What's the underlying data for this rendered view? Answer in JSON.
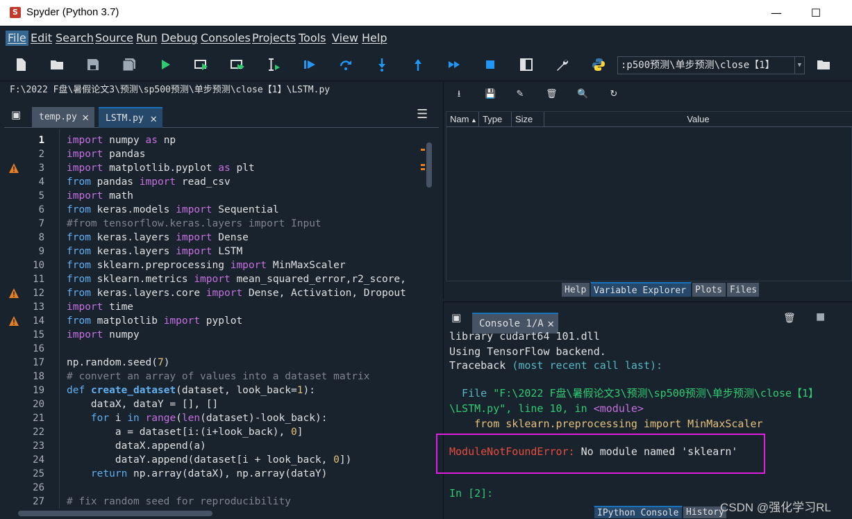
{
  "window": {
    "title": "Spyder (Python 3.7)",
    "minimize": "—",
    "maximize": "☐"
  },
  "menu": [
    "File",
    "Edit",
    "Search",
    "Source",
    "Run",
    "Debug",
    "Consoles",
    "Projects",
    "Tools",
    "View",
    "Help"
  ],
  "toolbar": {
    "path_value": ":p500预测\\单步预测\\close【1】"
  },
  "editor": {
    "file_path": "F:\\2022 F盘\\暑假论文3\\预测\\sp500预测\\单步预测\\close【1】\\LSTM.py",
    "tabs": [
      {
        "label": "temp.py",
        "active": false
      },
      {
        "label": "LSTM.py",
        "active": true
      }
    ],
    "current_line": 1,
    "warning_lines": [
      3,
      12,
      14
    ],
    "line_numbers": [
      "1",
      "2",
      "3",
      "4",
      "5",
      "6",
      "7",
      "8",
      "9",
      "10",
      "11",
      "12",
      "13",
      "14",
      "15",
      "16",
      "17",
      "18",
      "19",
      "20",
      "21",
      "22",
      "23",
      "24",
      "25",
      "26",
      "27"
    ],
    "lines": [
      "import numpy as np",
      "import pandas",
      "import matplotlib.pyplot as plt",
      "from pandas import read_csv",
      "import math",
      "from keras.models import Sequential",
      "#from tensorflow.keras.layers import Input",
      "from keras.layers import Dense",
      "from keras.layers import LSTM",
      "from sklearn.preprocessing import MinMaxScaler",
      "from sklearn.metrics import mean_squared_error,r2_score,",
      "from keras.layers.core import Dense, Activation, Dropout",
      "import time",
      "from matplotlib import pyplot",
      "import numpy",
      "",
      "np.random.seed(7)",
      "# convert an array of values into a dataset matrix",
      "def create_dataset(dataset, look_back=1):",
      "    dataX, dataY = [], []",
      "    for i in range(len(dataset)-look_back):",
      "        a = dataset[i:(i+look_back), 0]",
      "        dataX.append(a)",
      "        dataY.append(dataset[i + look_back, 0])",
      "    return np.array(dataX), np.array(dataY)",
      "",
      "# fix random seed for reproducibility"
    ]
  },
  "variable_explorer": {
    "columns": [
      "Nam",
      "Type",
      "Size",
      "Value"
    ],
    "tabs": [
      "Help",
      "Variable Explorer",
      "Plots",
      "Files"
    ],
    "active_tab": "Variable Explorer"
  },
  "console": {
    "tab_label": "Console 1/A",
    "lines": {
      "l1": "library cudart64_101.dll",
      "l2": "Using TensorFlow backend.",
      "l3_a": "Traceback ",
      "l3_b": "(most recent call last):",
      "l4_a": "  File ",
      "l4_b": "\"F:\\2022 F盘\\暑假论文3\\预测\\sp500预测\\单步预测\\close【1】",
      "l5_a": "\\LSTM.py\", line 10, in ",
      "l5_b": "<module>",
      "l6": "    from sklearn.preprocessing import MinMaxScaler",
      "err_name": "ModuleNotFoundError:",
      "err_msg": " No module named 'sklearn'",
      "prompt": "In [2]:"
    },
    "bottom_tabs": [
      "IPython Console",
      "History"
    ],
    "active_tab": "IPython Console"
  },
  "watermark": "CSDN @强化学习RL",
  "colors": {
    "background": "#19232d",
    "accent": "#1a72bb",
    "error": "#e74c3c",
    "highlight_box": "#e01ee0"
  }
}
